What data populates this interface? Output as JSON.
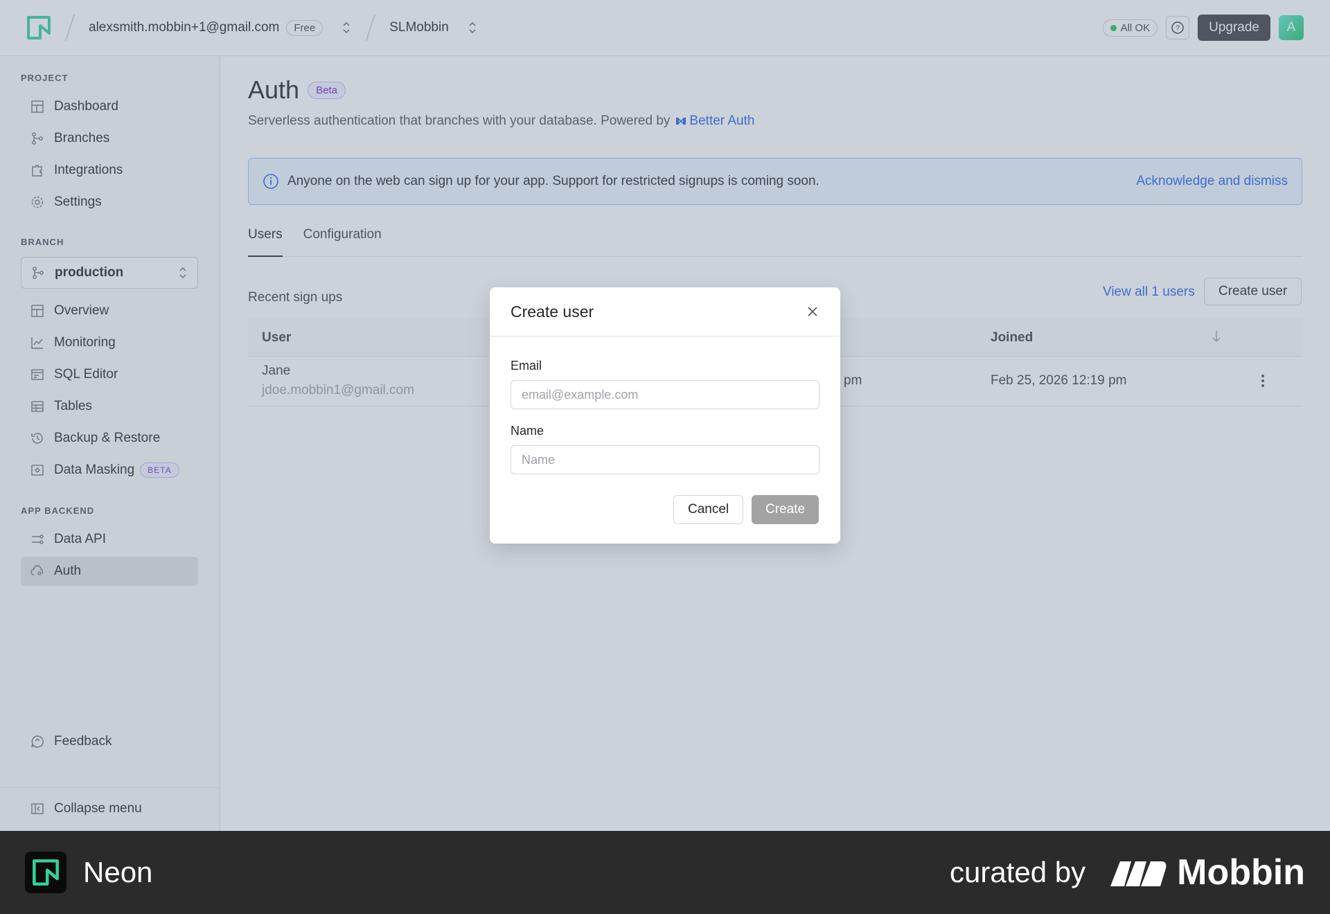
{
  "topbar": {
    "account_email": "alexsmith.mobbin+1@gmail.com",
    "plan_badge": "Free",
    "project_name": "SLMobbin",
    "status_label": "All OK",
    "upgrade_label": "Upgrade",
    "avatar_initial": "A"
  },
  "sidebar": {
    "project_section": "PROJECT",
    "project_items": [
      "Dashboard",
      "Branches",
      "Integrations",
      "Settings"
    ],
    "branch_section": "BRANCH",
    "branch_value": "production",
    "branch_items": [
      "Overview",
      "Monitoring",
      "SQL Editor",
      "Tables",
      "Backup & Restore",
      "Data Masking"
    ],
    "data_masking_badge": "BETA",
    "backend_section": "APP BACKEND",
    "backend_items": [
      "Data API",
      "Auth"
    ],
    "feedback_label": "Feedback",
    "collapse_label": "Collapse menu"
  },
  "main": {
    "title": "Auth",
    "title_badge": "Beta",
    "subtitle": "Serverless authentication that branches with your database. Powered by",
    "subtitle_link": "Better Auth",
    "banner_text": "Anyone on the web can sign up for your app. Support for restricted signups is coming soon.",
    "banner_action": "Acknowledge and dismiss",
    "tabs": [
      "Users",
      "Configuration"
    ],
    "recent_label": "Recent sign ups",
    "view_all_label": "View all 1 users",
    "create_user_label": "Create user",
    "table": {
      "headers": [
        "User",
        "Joined"
      ],
      "rows": [
        {
          "name": "Jane",
          "email": "jdoe.mobbin1@gmail.com",
          "partial": "pm",
          "joined": "Feb 25, 2026 12:19 pm"
        }
      ]
    }
  },
  "modal": {
    "title": "Create user",
    "email_label": "Email",
    "email_placeholder": "email@example.com",
    "name_label": "Name",
    "name_placeholder": "Name",
    "cancel_label": "Cancel",
    "create_label": "Create"
  },
  "footer": {
    "app_name": "Neon",
    "curated_by": "curated by",
    "brand": "Mobbin"
  },
  "colors": {
    "accent": "#2563eb",
    "brand_green": "#34d399",
    "overlay": "#6e7d96"
  }
}
